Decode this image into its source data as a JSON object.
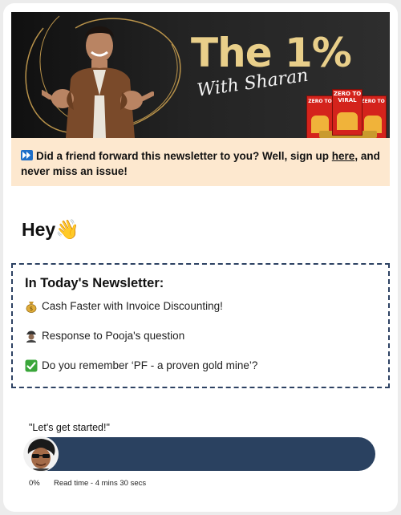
{
  "banner": {
    "title": "The 1%",
    "subtitle": "With Sharan",
    "book_title_line1": "ZERO TO",
    "book_title_line2": "VIRAL",
    "colors": {
      "title": "#e9cf8a",
      "background": "#1a1a1a",
      "book": "#d4231c"
    }
  },
  "signup": {
    "text_before": "Did a friend forward this newsletter to you? Well, sign up ",
    "link_text": "here",
    "text_after": ", and never miss an issue!",
    "background": "#fde8cf"
  },
  "greeting": {
    "text": "Hey",
    "emoji": "👋"
  },
  "newsletter": {
    "heading": "In Today's Newsletter:",
    "items": [
      {
        "icon": "money-bag-icon",
        "label": "Cash Faster with Invoice Discounting!"
      },
      {
        "icon": "detective-icon",
        "label": "Response to Pooja's question"
      },
      {
        "icon": "check-mark-icon",
        "label": "Do you remember ‘PF - a proven gold mine’?"
      }
    ],
    "border_color": "#2d4263"
  },
  "progress": {
    "caption": "\"Let's get started!\"",
    "percent_label": "0%",
    "progress_value": 0,
    "read_time": "Read time - 4 mins 30 secs",
    "bar_color": "#2a4160"
  }
}
